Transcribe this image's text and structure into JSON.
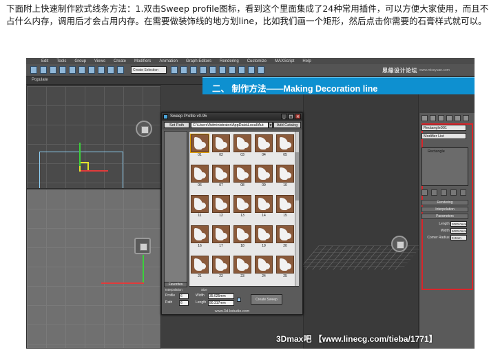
{
  "article": {
    "intro_text": "下面附上快速制作欧式线条方法：1.双击Sweep profile图标，看到这个里面集成了24种常用插件，可以方便大家使用，而且不占什么内存，调用后才会占用内存。在需要做装饰线的地方划line，比如我们画一个矩形，然后点击你需要的石膏样式就可以。"
  },
  "app": {
    "menu_items": [
      "Edit",
      "Tools",
      "Group",
      "Views",
      "Create",
      "Modifiers",
      "Animation",
      "Graph Editors",
      "Rendering",
      "Customize",
      "MAXScript",
      "Help"
    ],
    "selection_set_placeholder": "Create Selection",
    "ribbon_label": "Populate",
    "site_logo": "思缘设计论坛",
    "site_url": "www.missyuan.com"
  },
  "banner": {
    "text": "二、 制作方法——Making Decoration line",
    "color": "#0e90d0"
  },
  "command_panel": {
    "object_name": "Rectangle001",
    "modifier_list": "Modifier List",
    "stack_item": "Rectangle",
    "rollouts": [
      "Rendering",
      "Interpolation",
      "Parameters"
    ],
    "params": [
      {
        "label": "Length:",
        "value": "2000.0mm"
      },
      {
        "label": "Width:",
        "value": "6000.0mm"
      },
      {
        "label": "Corner Radius:",
        "value": "0.0mm"
      }
    ],
    "highlight_color": "#d9252a"
  },
  "plugin": {
    "title": "Sweep Profile v0.95",
    "set_path_label": "Set Path",
    "path_value": "C:\\Users\\Administrator\\AppData\\Local\\Aut",
    "add_catalog_label": "Add Catalog",
    "favorites_label": "Favorites",
    "thumbnails": [
      "01",
      "02",
      "03",
      "04",
      "05",
      "06",
      "07",
      "08",
      "09",
      "10",
      "11",
      "12",
      "13",
      "14",
      "15",
      "16",
      "17",
      "18",
      "19",
      "20",
      "21",
      "22",
      "23",
      "24",
      "25"
    ],
    "interpolation_label": "Interpolation",
    "size_label": "Size",
    "profile_label": "Profile",
    "profile_value": "6",
    "path_label": "Path",
    "path_steps": "6",
    "width_label": "Width",
    "width_value": "35.025mm",
    "length_label": "Length",
    "length_value": "80.317mm",
    "create_label": "Create Sweep",
    "footer_url": "www.3d-kstudio.com"
  },
  "watermark": "3Dmax吧 【www.linecg.com/tieba/1771】"
}
